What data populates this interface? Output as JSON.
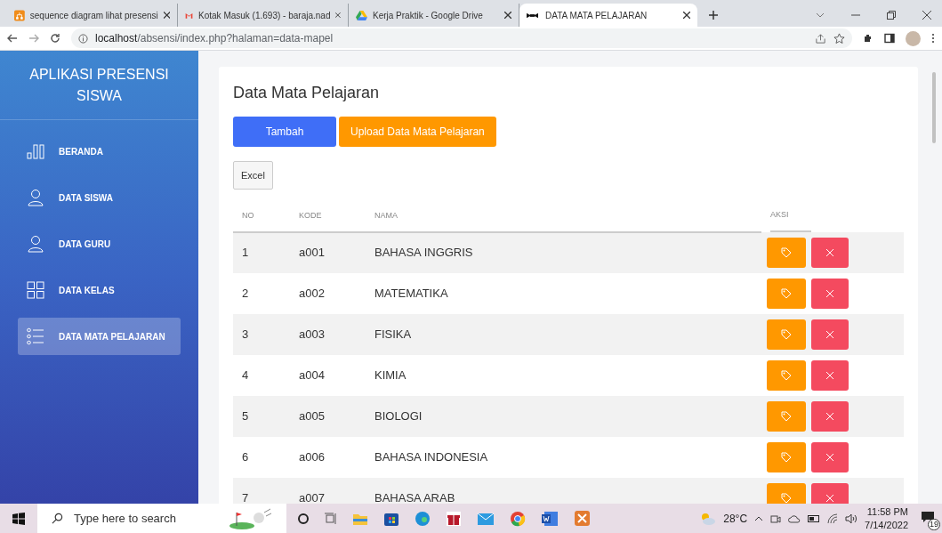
{
  "browser": {
    "tabs": [
      {
        "title": "sequence diagram lihat presensi",
        "kind": "diagram",
        "selected": false
      },
      {
        "title": "Kotak Masuk (1.693) - baraja.nad",
        "kind": "mail",
        "selected": false
      },
      {
        "title": "Kerja Praktik - Google Drive",
        "kind": "drive",
        "selected": false
      },
      {
        "title": "DATA MATA PELAJARAN",
        "kind": "app",
        "selected": true
      }
    ],
    "url_host": "localhost",
    "url_path": "/absensi/index.php?halaman=data-mapel"
  },
  "sidebar": {
    "title": "APLIKASI PRESENSI SISWA",
    "items": [
      {
        "label": "BERANDA",
        "selected": false
      },
      {
        "label": "DATA SISWA",
        "selected": false
      },
      {
        "label": "DATA GURU",
        "selected": false
      },
      {
        "label": "DATA KELAS",
        "selected": false
      },
      {
        "label": "DATA MATA PELAJARAN",
        "selected": true
      }
    ]
  },
  "page": {
    "title": "Data Mata Pelajaran",
    "add_button": "Tambah",
    "upload_button": "Upload Data Mata Pelajaran",
    "export_button": "Excel",
    "table": {
      "columns": [
        "NO",
        "KODE",
        "NAMA",
        "AKSI"
      ],
      "rows": [
        {
          "no": "1",
          "kode": "a001",
          "nama": "BAHASA INGGRIS"
        },
        {
          "no": "2",
          "kode": "a002",
          "nama": "MATEMATIKA"
        },
        {
          "no": "3",
          "kode": "a003",
          "nama": "FISIKA"
        },
        {
          "no": "4",
          "kode": "a004",
          "nama": "KIMIA"
        },
        {
          "no": "5",
          "kode": "a005",
          "nama": "BIOLOGI"
        },
        {
          "no": "6",
          "kode": "a006",
          "nama": "BAHASA INDONESIA"
        },
        {
          "no": "7",
          "kode": "a007",
          "nama": "BAHASA ARAB"
        }
      ]
    }
  },
  "taskbar": {
    "search_placeholder": "Type here to search",
    "temperature": "28°C",
    "time": "11:58 PM",
    "date": "7/14/2022",
    "notifications": "19"
  }
}
